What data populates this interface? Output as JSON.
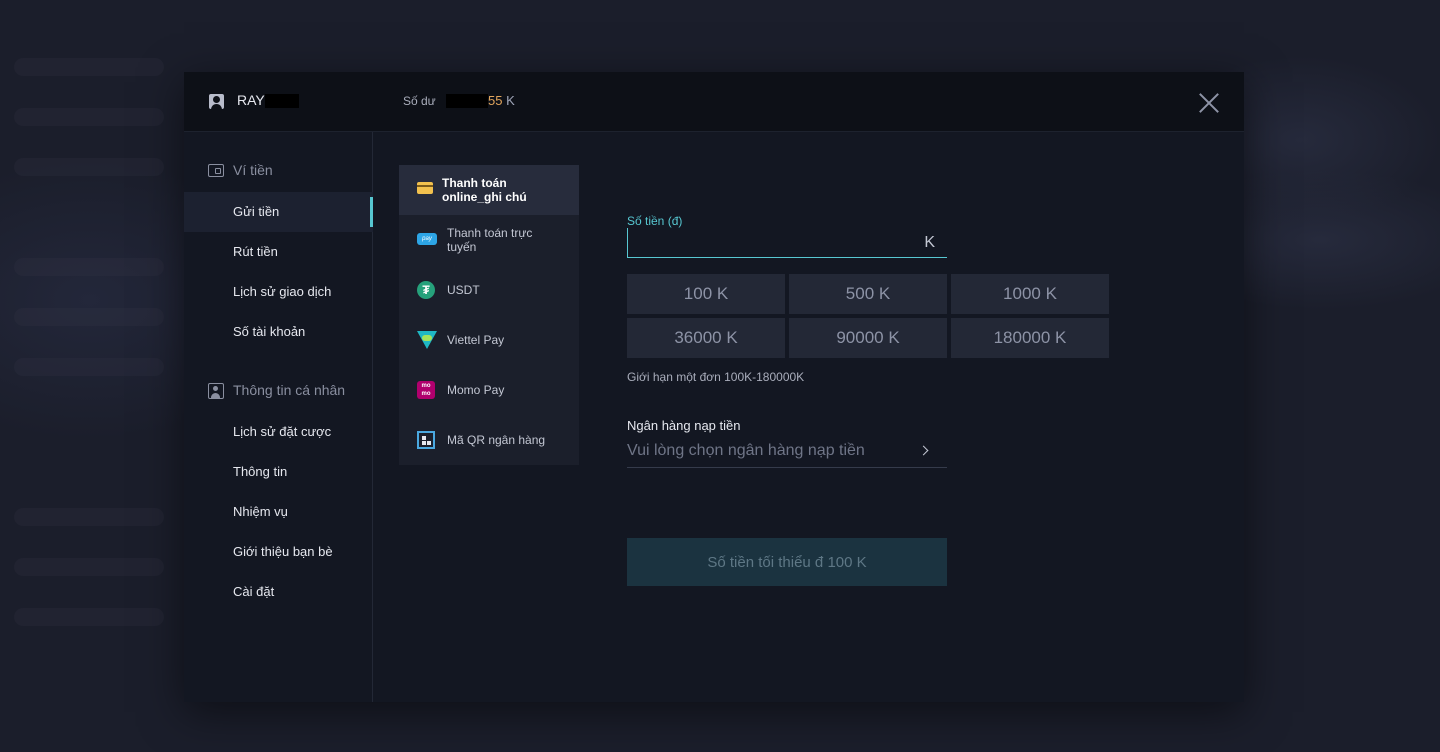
{
  "header": {
    "username": "RAY",
    "balance_label": "Số dư",
    "balance_value": "55",
    "balance_unit": "K"
  },
  "sidebar": {
    "wallet_section": "Ví tiền",
    "wallet_items": [
      "Gửi tiền",
      "Rút tiền",
      "Lịch sử giao dịch",
      "Số tài khoản"
    ],
    "profile_section": "Thông tin cá nhân",
    "profile_items": [
      "Lịch sử đặt cược",
      "Thông tin",
      "Nhiệm vụ",
      "Giới thiệu bạn bè",
      "Cài đặt"
    ],
    "active_item": "Gửi tiền"
  },
  "methods": [
    {
      "line1": "Thanh toán",
      "line2": "online_ghi chú",
      "icon": "card-icon",
      "active": true
    },
    {
      "line1": "Thanh toán trực",
      "line2": "tuyến",
      "icon": "pay-icon",
      "active": false
    },
    {
      "line1": "USDT",
      "line2": "",
      "icon": "usdt-icon",
      "active": false
    },
    {
      "line1": "Viettel Pay",
      "line2": "",
      "icon": "viettel-pay-icon",
      "active": false
    },
    {
      "line1": "Momo Pay",
      "line2": "",
      "icon": "momo-icon",
      "active": false
    },
    {
      "line1": "Mã QR ngân hàng",
      "line2": "",
      "icon": "qr-icon",
      "active": false
    }
  ],
  "form": {
    "amount_label": "Số tiền (đ)",
    "amount_value": "",
    "amount_unit": "K",
    "presets": [
      "100 K",
      "500 K",
      "1000 K",
      "36000 K",
      "90000 K",
      "180000 K"
    ],
    "limit_note": "Giới hạn một đơn 100K-180000K",
    "bank_label": "Ngân hàng nạp tiền",
    "bank_placeholder": "Vui lòng chọn ngân hàng nạp tiền",
    "submit_label": "Số tiền tối thiểu đ 100 K"
  },
  "colors": {
    "accent": "#57c7d1",
    "balance": "#e0a45c",
    "modal_bg": "#131722"
  }
}
